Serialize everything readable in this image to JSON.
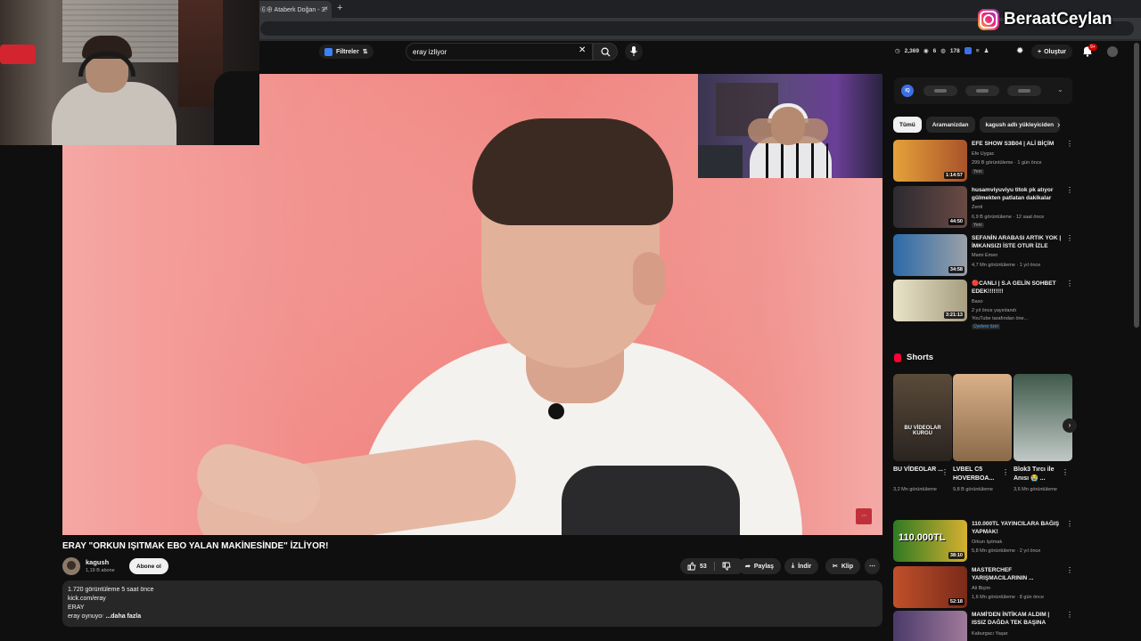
{
  "browser": {
    "tab_title": "Ⓖ⊕ Ataberk Doğan - 3.",
    "tab_close": "×",
    "new_tab": "+"
  },
  "overlay": {
    "streamer_name": "BeraatCeylan",
    "instagram_brand": "#e1306c"
  },
  "header": {
    "filter_label": "Filtreler",
    "search_value": "eray izliyor",
    "search_clear": "✕",
    "stats": [
      "2,369",
      "6",
      "178"
    ],
    "create_label": "Oluştur",
    "notifications_badge": "9+"
  },
  "video": {
    "title": "ERAY \"ORKUN IŞITMAK EBO YALAN MAKİNESİNDE\" İZLİYOR!",
    "channel_name": "kagush",
    "channel_subs": "1,19 B abone",
    "subscribe_label": "Abone ol",
    "like_count": "53",
    "share_label": "Paylaş",
    "download_label": "İndir",
    "clip_label": "Klip",
    "watermark": "↓↓↓",
    "description": {
      "views_time": "1.720 görüntüleme  5 saat önce",
      "line1": "kick.com/eray",
      "line2": "ERAY",
      "line3_visible": "eray oynuyo",
      "line3_faded": "r",
      "more": "...daha fazla"
    }
  },
  "sidebar": {
    "chips": [
      "Tümü",
      "Aramanizdan",
      "kagush adlı yükleyiciden"
    ],
    "recommendations": [
      {
        "title": "EFE SHOW S3B04 | ALİ BİÇİM",
        "channel": "Efe Uygac",
        "meta": "299 B görüntüleme · 1 gün önce",
        "badge": "Yeni",
        "duration": "1:14:57",
        "thumb": "#d98a3a"
      },
      {
        "title": "husamviyuviyu titok pk atıyor gülmekten patlatan dakikalar",
        "channel": "Zenti",
        "meta": "6,9 B görüntüleme · 12 saat önce",
        "badge": "Yeni",
        "duration": "44:50",
        "thumb": "#4a3a3a"
      },
      {
        "title": "SEFANİN ARABASI ARTIK YOK | İMKANSIZI İSTE OTUR İZLE",
        "channel": "Mami Emen",
        "meta": "4,7 Mn görüntüleme · 1 yıl önce",
        "badge": "",
        "duration": "34:58",
        "thumb": "#2c6aa8"
      },
      {
        "title": "🔴CANLI | S.A GELİN SOHBET EDEK!!!!!!!!",
        "channel": "Baso",
        "meta": "2 yıl önce yayınlandı",
        "meta2": "YouTube tarafından öne...",
        "badge": "Üyelere özel",
        "duration": "3:21:13",
        "thumb": "#c9c3a8"
      }
    ],
    "shorts_title": "Shorts",
    "shorts": [
      {
        "title": "BU VİDEOLAR ...",
        "views": "3,2 Mn görüntüleme",
        "overlay": "BU VİDEOLAR KURGU",
        "thumb": "#3a3028"
      },
      {
        "title": "LVBEL C5 HOVERBOA...",
        "views": "9,8 B görüntüleme",
        "overlay": "",
        "thumb": "#c9a37a"
      },
      {
        "title": "Blok3 Tırcı ile Anısı 😭 ...",
        "views": "3,6 Mn görüntüleme",
        "overlay": "",
        "thumb": "#3f5a4a"
      }
    ],
    "more_recs": [
      {
        "title": "110.000TL YAYINCILARA BAĞIŞ YAPMAK!",
        "channel": "Orkun Işıtmak",
        "meta": "5,8 Mn görüntüleme · 2 yıl önce",
        "duration": "38:10",
        "thumb": "#3f8a2a",
        "overlay": "110.000TL"
      },
      {
        "title": "MASTERCHEF YARIŞMACILARININ ...",
        "channel": "Ali Biçim",
        "meta": "1,6 Mn görüntüleme · 8 gün önce",
        "duration": "52:18",
        "thumb": "#b04a2a",
        "overlay": ""
      },
      {
        "title": "MAMİ'DEN İNTİKAM ALDIM | ISSIZ DAĞDA TEK BAŞINA",
        "channel": "Kaburgacı Yaşar",
        "meta": "",
        "duration": "",
        "thumb": "#7a5a8a",
        "overlay": ""
      }
    ]
  },
  "colors": {
    "bg": "#0f0f0f",
    "accent_red": "#ff0033",
    "chip_active": "#f1f1f1"
  }
}
